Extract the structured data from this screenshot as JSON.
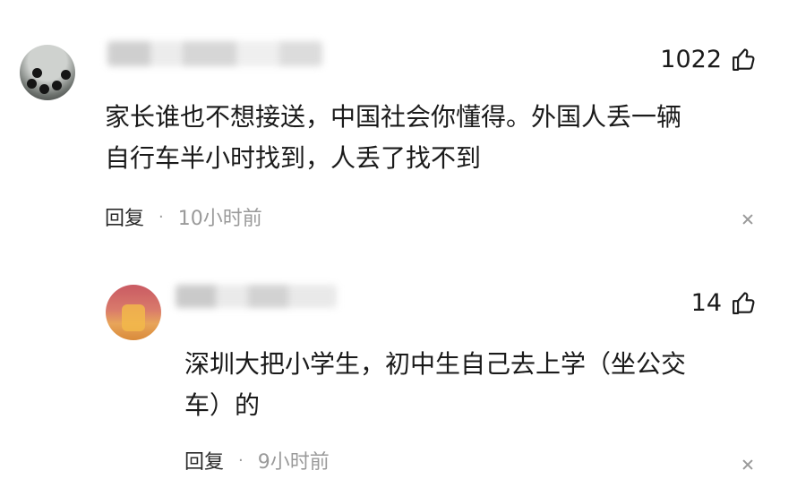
{
  "comments": [
    {
      "likes": "1022",
      "text": "家长谁也不想接送，中国社会你懂得。外国人丢一辆\n自行车半小时找到，人丢了找不到",
      "reply_label": "回复",
      "separator": "·",
      "time": "10小时前",
      "like_icon": "thumbs-up-icon",
      "close_icon": "close-icon"
    },
    {
      "likes": "14",
      "text": "深圳大把小学生，初中生自己去上学（坐公交\n车）的",
      "reply_label": "回复",
      "separator": "·",
      "time": "9小时前",
      "like_icon": "thumbs-up-icon",
      "close_icon": "close-icon"
    }
  ]
}
